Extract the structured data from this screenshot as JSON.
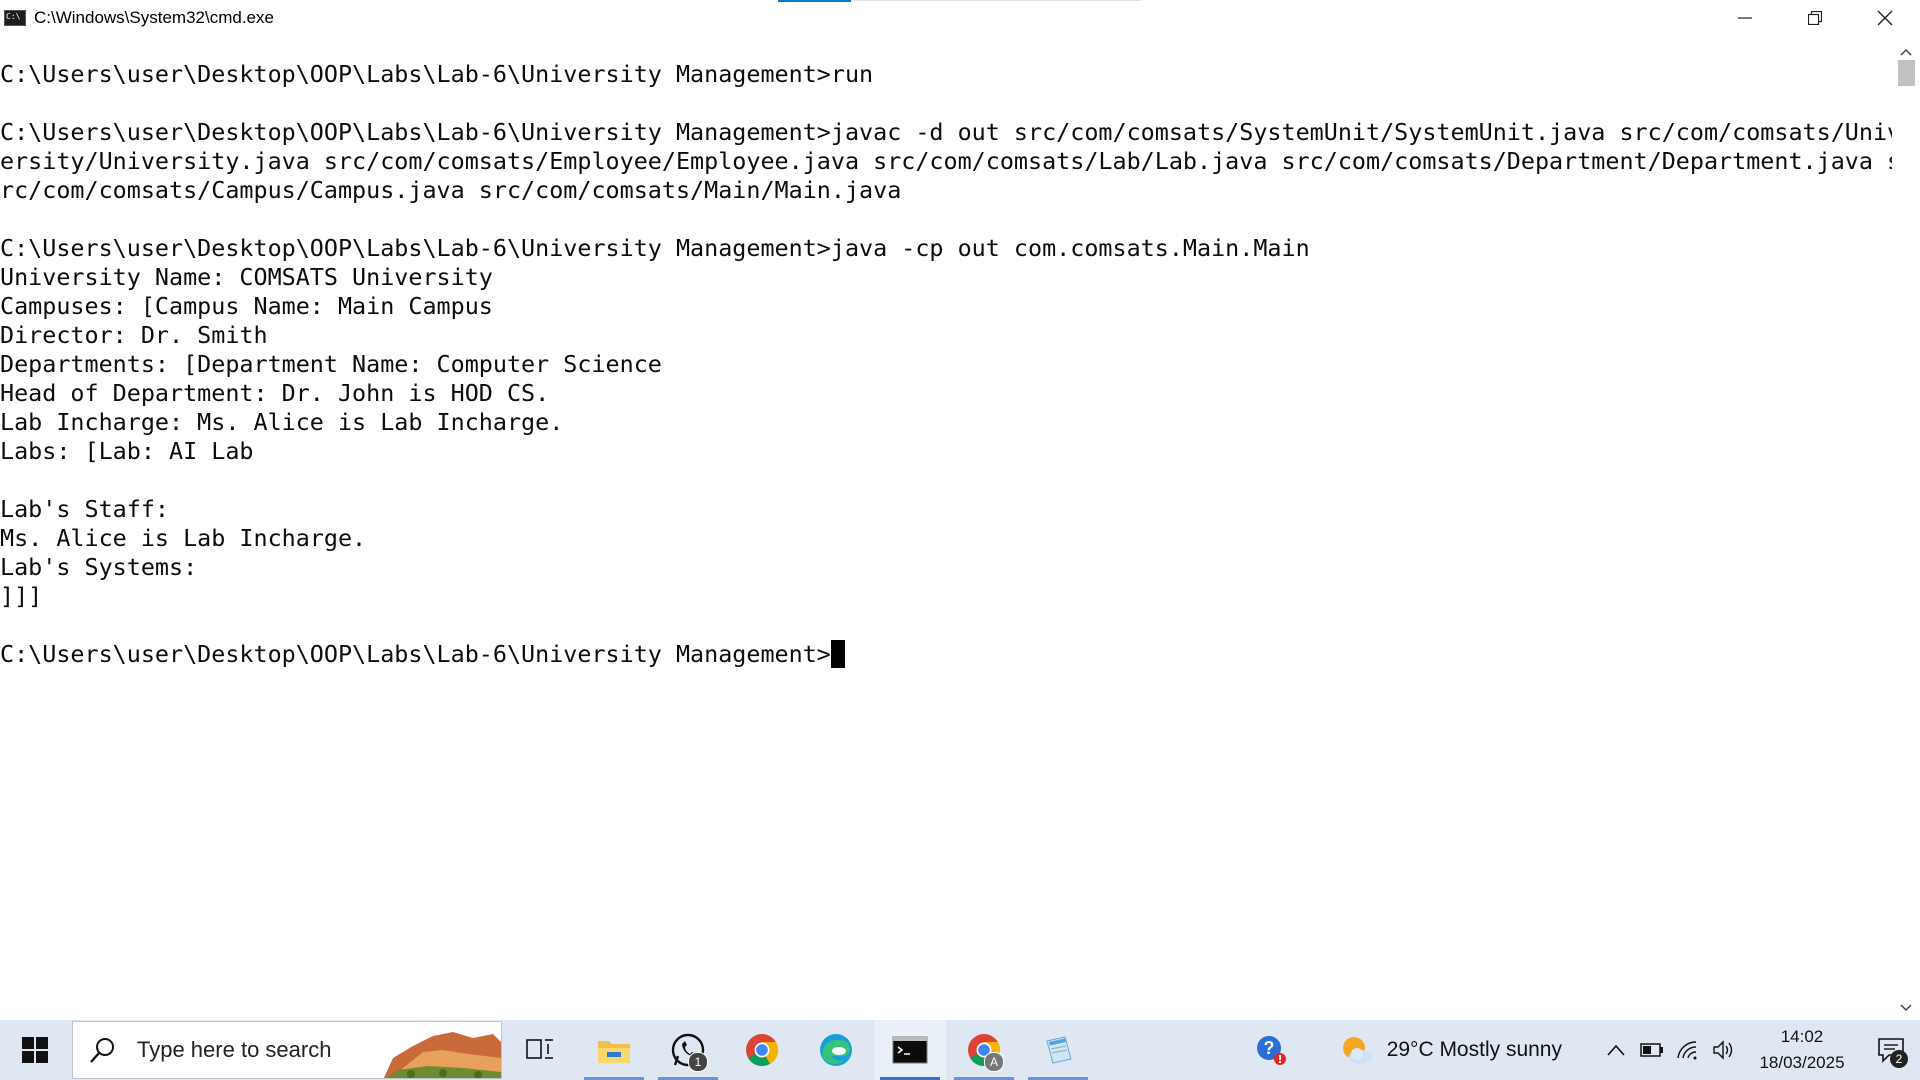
{
  "window": {
    "title": "C:\\Windows\\System32\\cmd.exe"
  },
  "console": {
    "lines": [
      "C:\\Users\\user\\Desktop\\OOP\\Labs\\Lab-6\\University Management>run",
      "",
      "C:\\Users\\user\\Desktop\\OOP\\Labs\\Lab-6\\University Management>javac -d out src/com/comsats/SystemUnit/SystemUnit.java src/com/comsats/Univ",
      "ersity/University.java src/com/comsats/Employee/Employee.java src/com/comsats/Lab/Lab.java src/com/comsats/Department/Department.java s",
      "rc/com/comsats/Campus/Campus.java src/com/comsats/Main/Main.java",
      "",
      "C:\\Users\\user\\Desktop\\OOP\\Labs\\Lab-6\\University Management>java -cp out com.comsats.Main.Main",
      "University Name: COMSATS University",
      "Campuses: [Campus Name: Main Campus",
      "Director: Dr. Smith",
      "Departments: [Department Name: Computer Science",
      "Head of Department: Dr. John is HOD CS.",
      "Lab Incharge: Ms. Alice is Lab Incharge.",
      "Labs: [Lab: AI Lab",
      "",
      "Lab's Staff:",
      "Ms. Alice is Lab Incharge.",
      "Lab's Systems:",
      "]]]",
      ""
    ],
    "prompt": "C:\\Users\\user\\Desktop\\OOP\\Labs\\Lab-6\\University Management>"
  },
  "taskbar": {
    "search_placeholder": "Type here to search",
    "apps": [
      {
        "icon": "task-view-icon"
      },
      {
        "icon": "file-explorer-icon"
      },
      {
        "icon": "whatsapp-icon",
        "badge": "1"
      },
      {
        "icon": "chrome-icon"
      },
      {
        "icon": "edge-icon"
      },
      {
        "icon": "cmd-icon"
      },
      {
        "icon": "chrome-profile-icon",
        "badge": "A"
      },
      {
        "icon": "notepad-icon"
      }
    ],
    "weather": "29°C  Mostly sunny",
    "time": "14:02",
    "date": "18/03/2025",
    "notification_count": "2"
  },
  "colors": {
    "taskbar_bg": "#dfe8f2",
    "accent": "#0078d4",
    "console_bg": "#ffffff",
    "console_fg": "#0c0c0c"
  }
}
